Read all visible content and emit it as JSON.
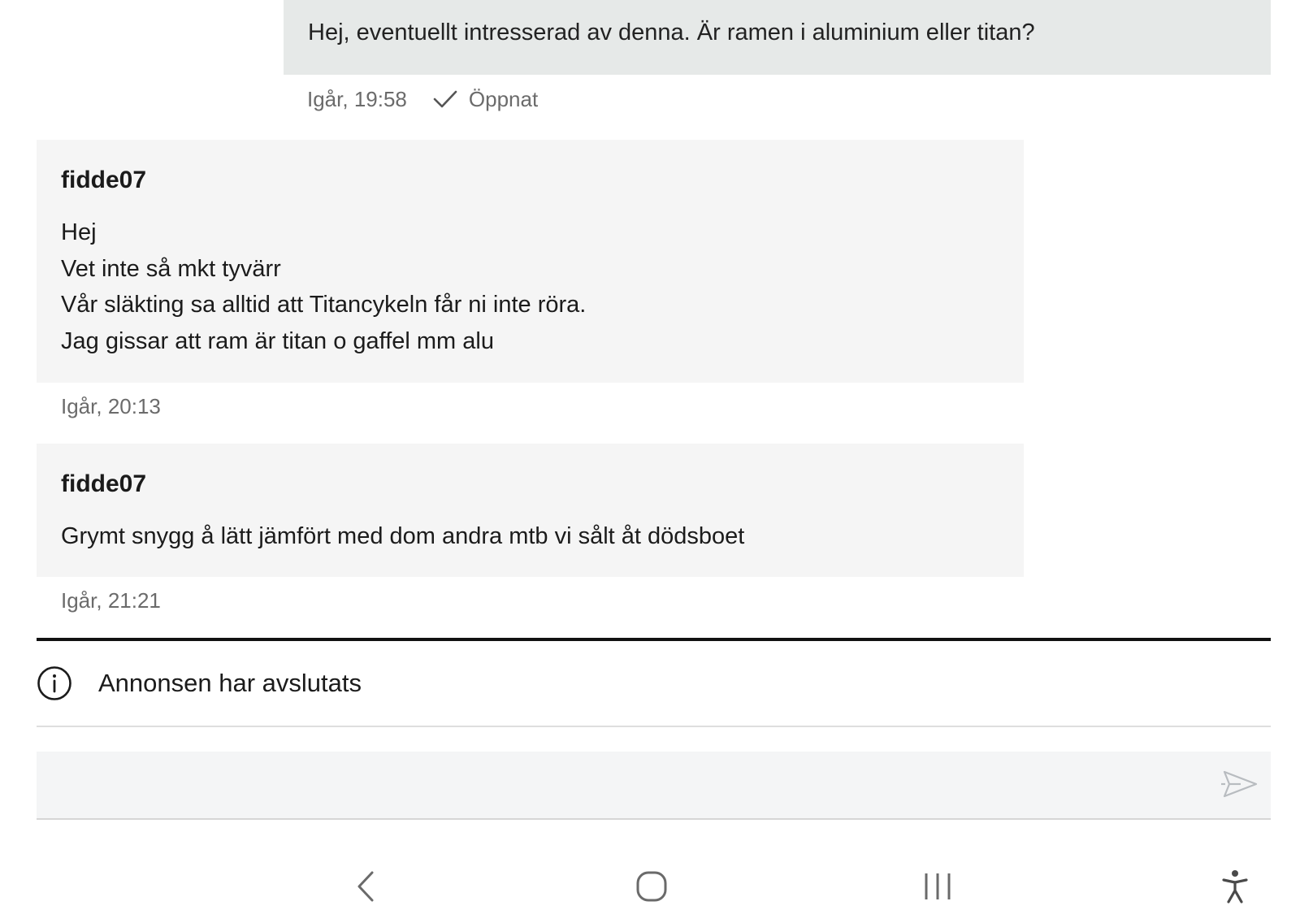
{
  "conversation": {
    "outgoing": {
      "text": "Hej, eventuellt intresserad av denna. Är ramen i aluminium eller titan?",
      "time": "Igår, 19:58",
      "status": "Öppnat"
    },
    "incoming": [
      {
        "sender": "fidde07",
        "lines": [
          "Hej",
          "Vet inte så mkt tyvärr",
          "Vår släkting sa alltid att Titancykeln får ni inte röra.",
          "Jag gissar att ram är titan o gaffel mm alu"
        ],
        "time": "Igår, 20:13"
      },
      {
        "sender": "fidde07",
        "lines": [
          "Grymt snygg å lätt jämfört med dom andra mtb vi sålt åt dödsboet"
        ],
        "time": "Igår, 21:21"
      }
    ]
  },
  "notice": {
    "icon": "info-icon",
    "text": "Annonsen har avslutats"
  },
  "composer": {
    "value": "",
    "placeholder": "",
    "send_icon": "send-icon"
  },
  "system_nav": {
    "icons": [
      "back-icon",
      "home-icon",
      "recent-apps-icon",
      "accessibility-icon"
    ]
  },
  "colors": {
    "outgoing_bubble": "#e6e9e8",
    "incoming_bubble": "#f5f5f5",
    "meta_text": "#6b6b6b",
    "divider": "#111111"
  }
}
